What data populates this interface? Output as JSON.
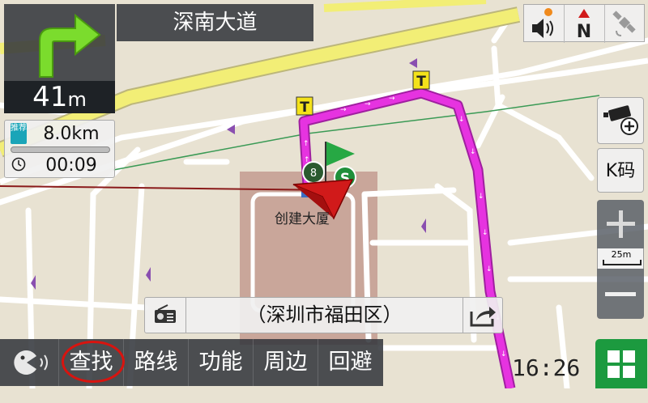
{
  "navigation": {
    "road_name": "深南大道",
    "turn_distance_value": "41",
    "turn_distance_unit": "m",
    "turn_direction_icon": "turn-right-arrow-icon"
  },
  "trip": {
    "badge": "推荐",
    "remaining_distance": "8.0km",
    "remaining_time": "00:09",
    "progress_fraction": 0.0
  },
  "top_right": {
    "sound_icon": "speaker-icon",
    "compass_label": "N",
    "gps_icon": "satellite-icon"
  },
  "side_controls": {
    "camera_icon": "camera-plus-icon",
    "kcode_label": "K码",
    "zoom_in_icon": "plus-icon",
    "zoom_out_icon": "minus-icon",
    "scale_label": "25m"
  },
  "address_bar": {
    "text": "（深圳市福田区）",
    "radio_icon": "radio-icon",
    "share_icon": "share-icon"
  },
  "bottom_bar": {
    "voice_icon": "voice-pacman-icon",
    "items": [
      "查找",
      "路线",
      "功能",
      "周边",
      "回避"
    ]
  },
  "map": {
    "poi_label": "创建大厦",
    "start_marker_label": "S",
    "bus_stop_number": "8",
    "toll_label": "T"
  },
  "status": {
    "time": "16:26"
  },
  "colors": {
    "route": "#e633e0",
    "main_road": "#f2ee76",
    "map_background": "#e8e2d2",
    "menu_green": "#1c9a3f"
  }
}
